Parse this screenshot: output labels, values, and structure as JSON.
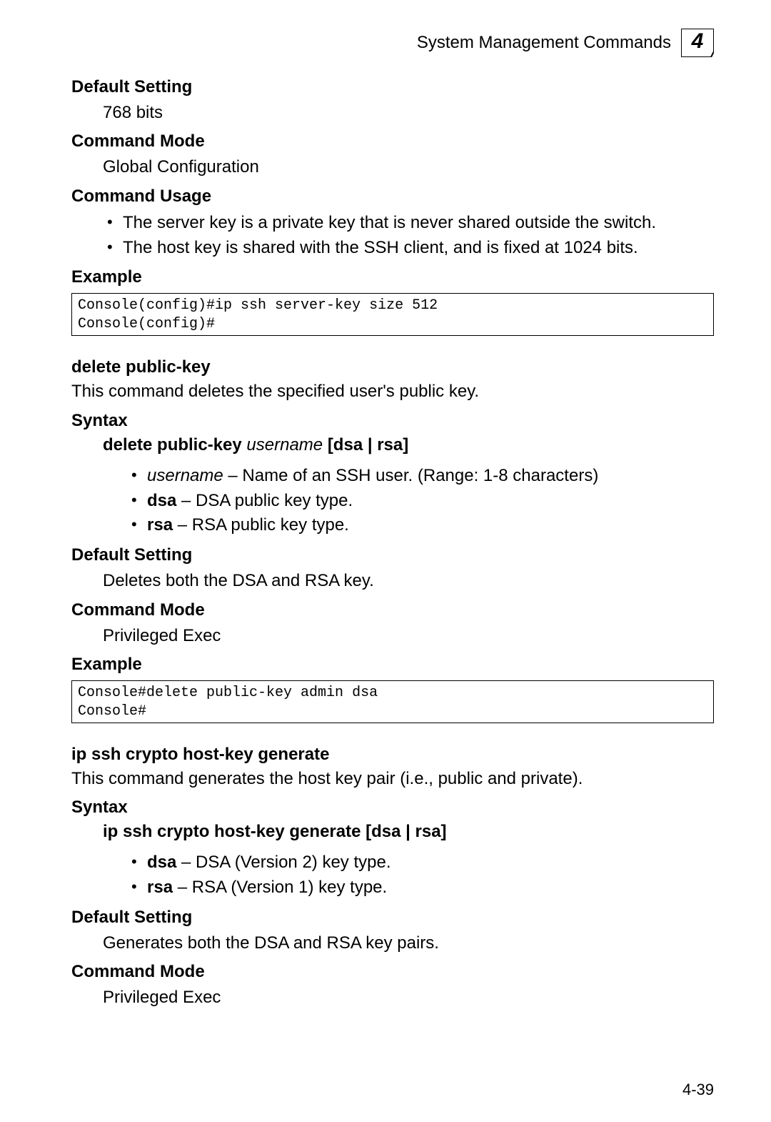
{
  "header": {
    "title": "System Management Commands",
    "chapter_number": "4"
  },
  "sec1": {
    "default_setting_h": "Default Setting",
    "default_setting_v": "768 bits",
    "command_mode_h": "Command Mode",
    "command_mode_v": "Global Configuration",
    "command_usage_h": "Command Usage",
    "usage": [
      "The server key is a private key that is never shared outside the switch.",
      "The host key is shared with the SSH client, and is fixed at 1024 bits."
    ],
    "example_h": "Example",
    "example_code": "Console(config)#ip ssh server-key size 512\nConsole(config)#"
  },
  "cmd2": {
    "title": "delete public-key",
    "desc": "This command deletes the specified user's public key.",
    "syntax_h": "Syntax",
    "syntax_bold1": "delete public-key",
    "syntax_ital": "username",
    "syntax_bold2": "[dsa | rsa]",
    "params": [
      {
        "name_ital": "username",
        "rest": " – Name of an SSH user. (Range: 1-8 characters)"
      },
      {
        "name_bold": "dsa",
        "rest": " – DSA public key type."
      },
      {
        "name_bold": "rsa",
        "rest": " – RSA public key type."
      }
    ],
    "default_setting_h": "Default Setting",
    "default_setting_v": "Deletes both the DSA and RSA key.",
    "command_mode_h": "Command Mode",
    "command_mode_v": "Privileged Exec",
    "example_h": "Example",
    "example_code": "Console#delete public-key admin dsa\nConsole#"
  },
  "cmd3": {
    "title": "ip ssh crypto host-key generate",
    "desc": "This command generates the host key pair (i.e., public and private).",
    "syntax_h": "Syntax",
    "syntax_bold1": "ip ssh crypto host-key generate",
    "syntax_bold2": "[dsa | rsa]",
    "params": [
      {
        "name_bold": "dsa",
        "rest": " – DSA (Version 2) key type."
      },
      {
        "name_bold": "rsa",
        "rest": " – RSA (Version 1) key type."
      }
    ],
    "default_setting_h": "Default Setting",
    "default_setting_v": "Generates both the DSA and RSA key pairs.",
    "command_mode_h": "Command Mode",
    "command_mode_v": "Privileged Exec"
  },
  "page_number": "4-39"
}
